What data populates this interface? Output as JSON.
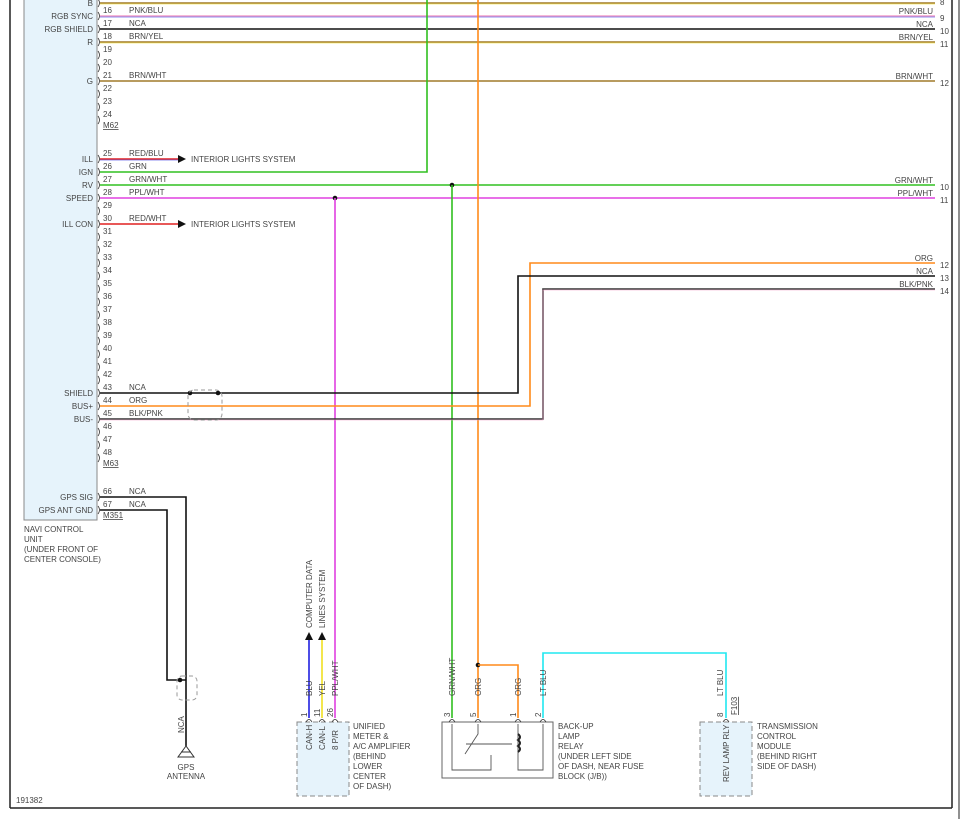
{
  "diagram_id": "191382",
  "colors": {
    "BRN": "#a07a2a",
    "PNK": "#f4a0c8",
    "BLU": "#2020e0",
    "NCA": "#111111",
    "YEL": "#f0e020",
    "RED": "#e02020",
    "GRN": "#30c020",
    "WHT": "#dddddd",
    "PPL": "#e040e0",
    "ORG": "#ff8a1a",
    "BLK": "#333333",
    "LTBLU": "#20e8f0",
    "box_fill": "#e6f3fb"
  },
  "navi_unit": {
    "name_lines": [
      "NAVI CONTROL",
      "UNIT",
      "(UNDER FRONT OF",
      "CENTER CONSOLE)"
    ],
    "top_pin": {
      "func": "B",
      "right_num": "8"
    },
    "connectors": [
      {
        "id": "M62",
        "pins": [
          {
            "num": "16",
            "func": "RGB SYNC",
            "wire": "PNK/BLU",
            "right_num": "9"
          },
          {
            "num": "17",
            "func": "RGB SHIELD",
            "wire": "NCA",
            "right_num": "10"
          },
          {
            "num": "18",
            "func": "R",
            "wire": "BRN/YEL",
            "right_num": "11"
          },
          {
            "num": "19",
            "func": "",
            "wire": ""
          },
          {
            "num": "20",
            "func": "",
            "wire": ""
          },
          {
            "num": "21",
            "func": "G",
            "wire": "BRN/WHT",
            "right_num": "12"
          },
          {
            "num": "22",
            "func": "",
            "wire": ""
          },
          {
            "num": "23",
            "func": "",
            "wire": ""
          },
          {
            "num": "24",
            "func": "",
            "wire": ""
          }
        ]
      },
      {
        "id": "M63",
        "pins": [
          {
            "num": "25",
            "func": "ILL",
            "wire": "RED/BLU",
            "arrow_to": "INTERIOR LIGHTS SYSTEM"
          },
          {
            "num": "26",
            "func": "IGN",
            "wire": "GRN"
          },
          {
            "num": "27",
            "func": "RV",
            "wire": "GRN/WHT",
            "right_num": "10"
          },
          {
            "num": "28",
            "func": "SPEED",
            "wire": "PPL/WHT",
            "right_num": "11"
          },
          {
            "num": "29",
            "func": "",
            "wire": ""
          },
          {
            "num": "30",
            "func": "ILL CON",
            "wire": "RED/WHT",
            "arrow_to": "INTERIOR LIGHTS SYSTEM"
          },
          {
            "num": "31",
            "func": "",
            "wire": ""
          },
          {
            "num": "32",
            "func": "",
            "wire": ""
          },
          {
            "num": "33",
            "func": "",
            "wire": ""
          },
          {
            "num": "34",
            "func": "",
            "wire": ""
          },
          {
            "num": "35",
            "func": "",
            "wire": ""
          },
          {
            "num": "36",
            "func": "",
            "wire": ""
          },
          {
            "num": "37",
            "func": "",
            "wire": ""
          },
          {
            "num": "38",
            "func": "",
            "wire": ""
          },
          {
            "num": "39",
            "func": "",
            "wire": ""
          },
          {
            "num": "40",
            "func": "",
            "wire": ""
          },
          {
            "num": "41",
            "func": "",
            "wire": ""
          },
          {
            "num": "42",
            "func": "",
            "wire": ""
          },
          {
            "num": "43",
            "func": "SHIELD",
            "wire": "NCA"
          },
          {
            "num": "44",
            "func": "BUS+",
            "wire": "ORG"
          },
          {
            "num": "45",
            "func": "BUS-",
            "wire": "BLK/PNK"
          },
          {
            "num": "46",
            "func": "",
            "wire": ""
          },
          {
            "num": "47",
            "func": "",
            "wire": ""
          },
          {
            "num": "48",
            "func": "",
            "wire": ""
          }
        ]
      },
      {
        "id": "M351",
        "pins": [
          {
            "num": "66",
            "func": "GPS SIG",
            "wire": "NCA"
          },
          {
            "num": "67",
            "func": "GPS ANT GND",
            "wire": "NCA"
          }
        ]
      }
    ]
  },
  "right_bus": [
    {
      "wire": "ORG",
      "right_num": "12"
    },
    {
      "wire": "NCA",
      "right_num": "13"
    },
    {
      "wire": "BLK/PNK",
      "right_num": "14"
    }
  ],
  "gps_antenna": {
    "wire": "NCA",
    "name_lines": [
      "GPS",
      "ANTENNA"
    ]
  },
  "amplifier": {
    "name_lines": [
      "UNIFIED",
      "METER &",
      "A/C AMPLIFIER",
      "(BEHIND",
      "LOWER",
      "CENTER",
      "OF DASH)"
    ],
    "pins": [
      {
        "num": "1",
        "func": "CAN-H",
        "wire": "BLU",
        "arrow_to": "COMPUTER DATA"
      },
      {
        "num": "11",
        "func": "CAN-L",
        "wire": "YEL",
        "arrow_to": "LINES SYSTEM"
      },
      {
        "num": "26",
        "func": "8 P/R",
        "wire": "PPL/WHT"
      }
    ]
  },
  "relay": {
    "name_lines": [
      "BACK-UP",
      "LAMP",
      "RELAY",
      "(UNDER LEFT SIDE",
      "OF DASH, NEAR FUSE",
      "BLOCK (J/B))"
    ],
    "pins": [
      {
        "num": "3",
        "wire": "GRN/WHT"
      },
      {
        "num": "5",
        "wire": "ORG"
      },
      {
        "num": "1",
        "wire": "ORG"
      },
      {
        "num": "2",
        "wire": "LT BLU"
      }
    ]
  },
  "tcm": {
    "name_lines": [
      "TRANSMISSION",
      "CONTROL",
      "MODULE",
      "(BEHIND RIGHT",
      "SIDE OF DASH)"
    ],
    "connector": "F103",
    "pin": {
      "num": "8",
      "func": "REV LAMP RLY",
      "wire": "LT BLU"
    }
  }
}
